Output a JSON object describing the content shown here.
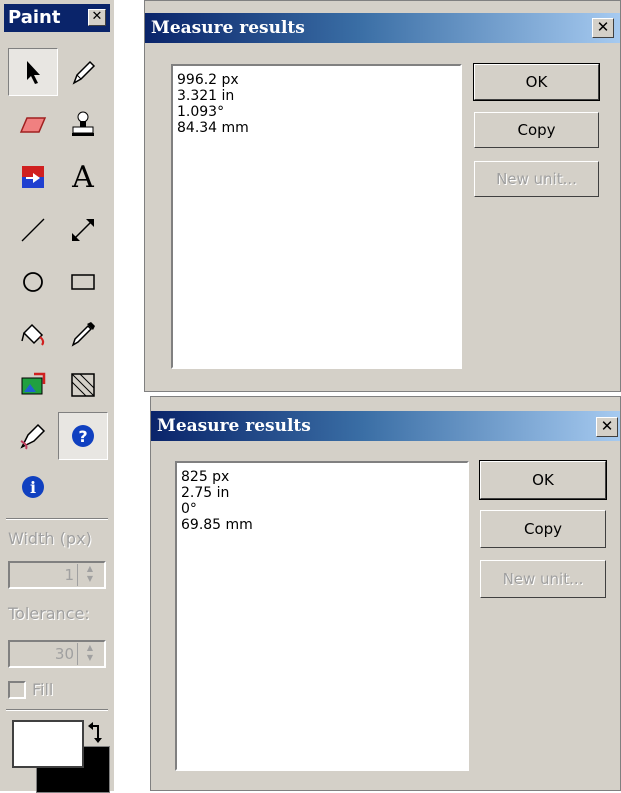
{
  "toolbox": {
    "title": "Paint",
    "close_symbol": "✕",
    "tools": [
      {
        "name": "select-arrow-icon"
      },
      {
        "name": "pen-icon"
      },
      {
        "name": "eraser-icon"
      },
      {
        "name": "stamp-icon"
      },
      {
        "name": "color-replace-icon"
      },
      {
        "name": "text-icon",
        "glyph": "A"
      },
      {
        "name": "line-icon"
      },
      {
        "name": "measure-icon"
      },
      {
        "name": "ellipse-icon"
      },
      {
        "name": "rectangle-icon"
      },
      {
        "name": "fill-bucket-icon"
      },
      {
        "name": "color-picker-icon"
      },
      {
        "name": "image-transform-icon"
      },
      {
        "name": "perspective-icon"
      },
      {
        "name": "smudge-icon"
      },
      {
        "name": "help-icon",
        "glyph": "?"
      },
      {
        "name": "info-icon",
        "glyph": "i"
      }
    ],
    "width_label": "Width (px)",
    "width_value": "1",
    "tolerance_label": "Tolerance:",
    "tolerance_value": "30",
    "fill_label": "Fill",
    "foreground_color": "#ffffff",
    "background_color": "#000000"
  },
  "dialog1": {
    "title": "Measure results",
    "close_symbol": "✕",
    "results": [
      "996.2 px",
      "3.321 in",
      "1.093°",
      "84.34 mm"
    ],
    "ok_label": "OK",
    "copy_label": "Copy",
    "new_unit_label": "New unit..."
  },
  "dialog2": {
    "title": "Measure results",
    "close_symbol": "✕",
    "results": [
      "825 px",
      "2.75 in",
      "0°",
      "69.85 mm"
    ],
    "ok_label": "OK",
    "copy_label": "Copy",
    "new_unit_label": "New unit..."
  }
}
